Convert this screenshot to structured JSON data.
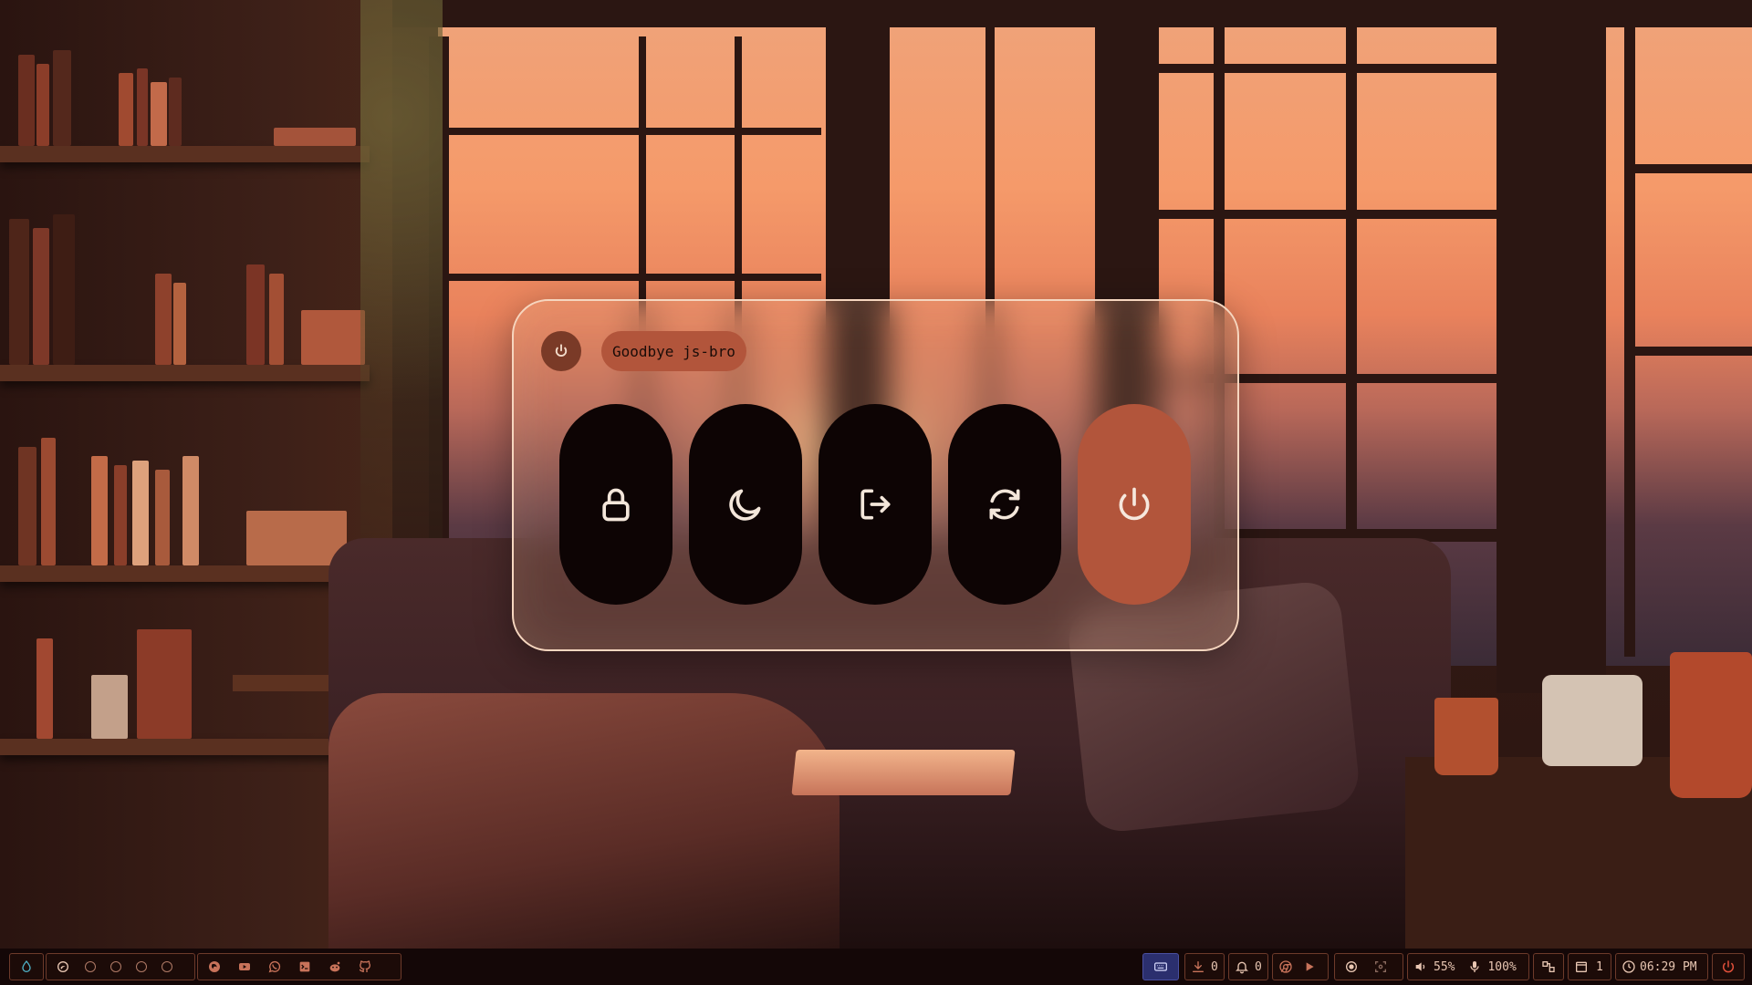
{
  "colors": {
    "accent": "#b2553b",
    "menu_border": "#f6d6bf",
    "button_dark": "#0d0404",
    "bar_bg": "#140707",
    "bar_text": "#e8c6b2"
  },
  "power_menu": {
    "header_icon": "power-icon",
    "greeting": "Goodbye js-bro",
    "actions": [
      {
        "icon": "lock-icon"
      },
      {
        "icon": "moon-icon"
      },
      {
        "icon": "logout-icon"
      },
      {
        "icon": "reboot-icon"
      },
      {
        "icon": "power-icon",
        "active": true
      }
    ]
  },
  "bar": {
    "left": {
      "launcher_icon": "droplet-icon",
      "workspaces": [
        {
          "icon": "swirl-icon",
          "active": true
        },
        {
          "active": false
        },
        {
          "active": false
        },
        {
          "active": false
        },
        {
          "active": false
        }
      ],
      "apps": [
        "firefox-icon",
        "youtube-icon",
        "whatsapp-icon",
        "terminal-icon",
        "reddit-icon",
        "github-icon"
      ]
    },
    "right": {
      "keyboard_icon": "keyboard-icon",
      "updates_count": "0",
      "notifications_count": "0",
      "media_icons": [
        "chrome-icon",
        "play-icon"
      ],
      "record_icon": "record-icon",
      "screenshot_icon": "screenshot-icon",
      "volume": "55%",
      "mic": "100%",
      "layout_icon": "layout-icon",
      "workspace_count": "1",
      "clock": "06:29 PM",
      "power_icon": "power-icon"
    }
  }
}
